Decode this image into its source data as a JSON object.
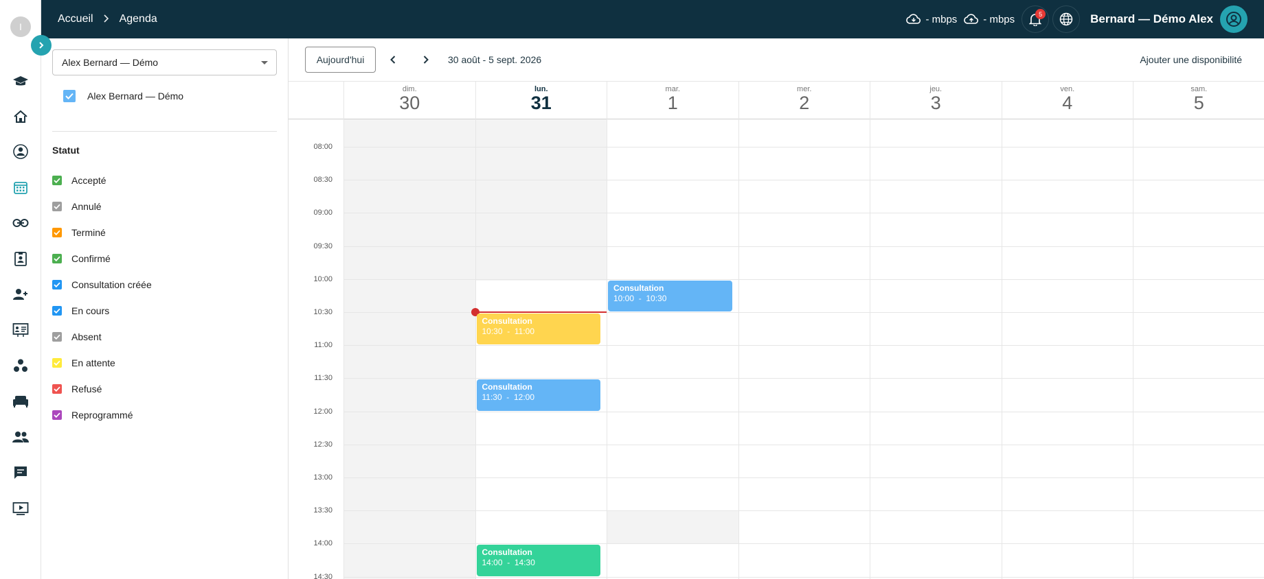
{
  "app": {
    "logo_letter": "I"
  },
  "breadcrumb": {
    "home": "Accueil",
    "current": "Agenda"
  },
  "topbar": {
    "download_speed": "- mbps",
    "upload_speed": "- mbps",
    "notification_count": "5",
    "user_name": "Bernard — Démo Alex"
  },
  "sidebar_icons": [
    "graduation-cap-icon",
    "home-icon",
    "doctor-icon",
    "calendar-icon",
    "link-icon",
    "id-badge-icon",
    "user-add-icon",
    "presentation-icon",
    "group-dots-icon",
    "sofa-icon",
    "people-icon",
    "chat-icon",
    "video-icon"
  ],
  "filters": {
    "practitioner_select": "Alex Bernard — Démo",
    "calendar_owner": "Alex Bernard — Démo",
    "status_title": "Statut",
    "statuses": [
      {
        "label": "Accepté",
        "color": "#4caf50"
      },
      {
        "label": "Annulé",
        "color": "#9e9e9e"
      },
      {
        "label": "Terminé",
        "color": "#ff9800"
      },
      {
        "label": "Confirmé",
        "color": "#4caf50"
      },
      {
        "label": "Consultation créée",
        "color": "#2196f3"
      },
      {
        "label": "En cours",
        "color": "#2196f3"
      },
      {
        "label": "Absent",
        "color": "#9e9e9e"
      },
      {
        "label": "En attente",
        "color": "#ffeb3b"
      },
      {
        "label": "Refusé",
        "color": "#ef5350"
      },
      {
        "label": "Reprogrammé",
        "color": "#ab47bc"
      }
    ]
  },
  "calendar": {
    "today_button": "Aujourd'hui",
    "range_label": "30 août - 5 sept. 2026",
    "add_availability": "Ajouter une disponibilité",
    "days": [
      {
        "name": "dim.",
        "num": "30"
      },
      {
        "name": "lun.",
        "num": "31",
        "today": true
      },
      {
        "name": "mar.",
        "num": "1"
      },
      {
        "name": "mer.",
        "num": "2"
      },
      {
        "name": "jeu.",
        "num": "3"
      },
      {
        "name": "ven.",
        "num": "4"
      },
      {
        "name": "sam.",
        "num": "5"
      }
    ],
    "time_labels": [
      "08:00",
      "08:30",
      "09:00",
      "09:30",
      "10:00",
      "10:30",
      "11:00",
      "11:30",
      "12:00",
      "12:30",
      "13:00",
      "13:30",
      "14:00",
      "14:30"
    ],
    "now_time": "10:30",
    "events": [
      {
        "title": "Consultation",
        "time": "10:00  -  10:30",
        "day": 2,
        "start": "10:00",
        "end": "10:30",
        "color": "#64b5f6"
      },
      {
        "title": "Consultation",
        "time": "10:30  -  11:00",
        "day": 1,
        "start": "10:30",
        "end": "11:00",
        "color": "#ffd54f"
      },
      {
        "title": "Consultation",
        "time": "11:30  -  12:00",
        "day": 1,
        "start": "11:30",
        "end": "12:00",
        "color": "#64b5f6"
      },
      {
        "title": "Consultation",
        "time": "14:00  -  14:30",
        "day": 1,
        "start": "14:00",
        "end": "14:30",
        "color": "#34d399"
      }
    ]
  }
}
